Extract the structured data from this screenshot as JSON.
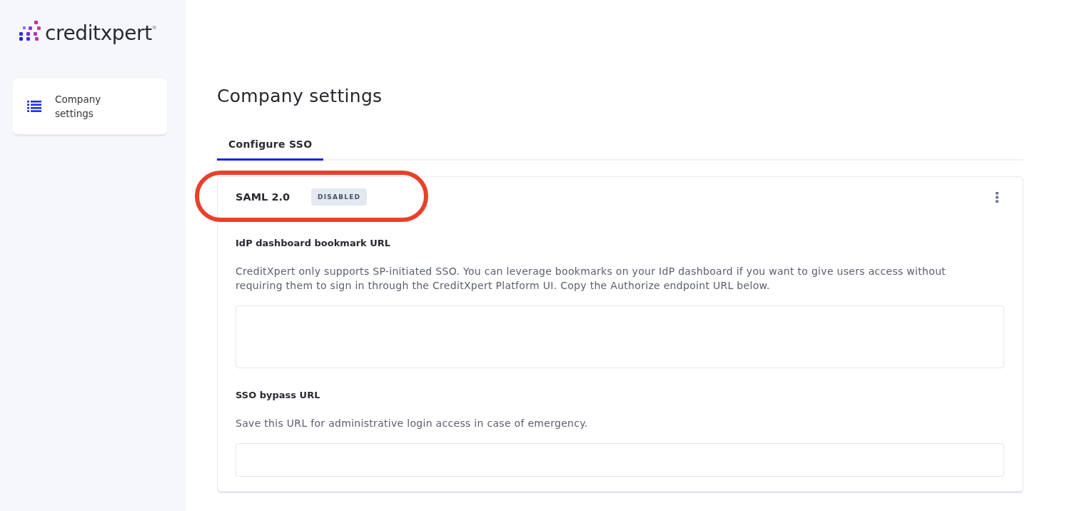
{
  "sidebar": {
    "logo": {
      "text": "creditxpert$^{®}$"
    },
    "items": [
      {
        "label": "Company settings",
        "selected": true
      }
    ]
  },
  "page": {
    "title": "Company settings"
  },
  "tabs": [
    {
      "label": "Configure SSO",
      "selected": true
    }
  ],
  "card": {
    "title": "SAML 2.0",
    "badge": "DISABLED",
    "sections": [
      {
        "heading": "IdP dashboard bookmark URL",
        "description": "CreditXpert only supports SP-initiated SSO. You can leverage bookmarks on your IdP dashboard if you want to give users access without requiring them to sign in through the CreditXpert Platform UI. Copy the Authorize endpoint URL below.",
        "field": {
          "kind": "multiline"
        }
      },
      {
        "heading": "SSO bypass URL",
        "description": "Save this URL for administrative login access in case of emergency.",
        "field": {
          "kind": "single"
        }
      }
    ]
  },
  "annotations": [
    {
      "kind": "outline"
    }
  ]
}
